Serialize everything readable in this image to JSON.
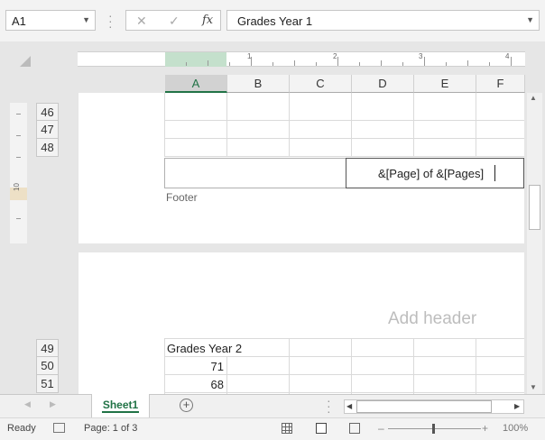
{
  "formula_bar": {
    "name_box": "A1",
    "cancel_icon": "✕",
    "enter_icon": "✓",
    "fx_label": "fx",
    "formula": "Grades Year 1"
  },
  "ruler": {
    "marks": [
      "1",
      "2",
      "3",
      "4"
    ]
  },
  "vruler": {
    "mark": "10"
  },
  "columns": [
    "A",
    "B",
    "C",
    "D",
    "E",
    "F"
  ],
  "page1": {
    "rows": [
      "46",
      "47",
      "48"
    ],
    "footer_label": "Footer",
    "footer_center_text": "&[Page] of &[Pages]"
  },
  "page2": {
    "header_placeholder": "Add header",
    "rows": [
      {
        "num": "49",
        "a": "Grades Year 2"
      },
      {
        "num": "50",
        "a": "71"
      },
      {
        "num": "51",
        "a": "68"
      }
    ]
  },
  "sheet_tabs": [
    "Sheet1"
  ],
  "status": {
    "ready": "Ready",
    "page_info": "Page: 1 of 3",
    "zoom": "100%"
  },
  "colors": {
    "accent": "#217346"
  }
}
